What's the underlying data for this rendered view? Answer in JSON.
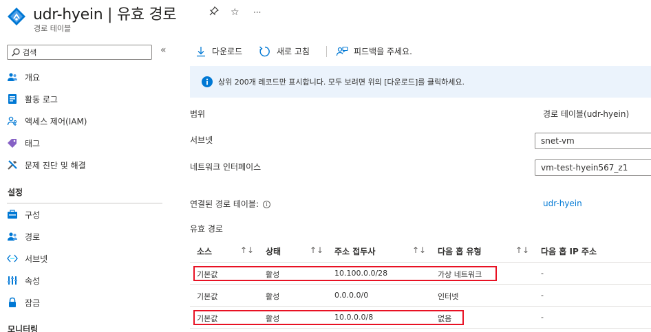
{
  "header": {
    "title": "udr-hyein | 유효 경로",
    "subtitle": "경로 테이블",
    "pin_glyph": "☆",
    "star_glyph": "☆",
    "more_glyph": "···"
  },
  "sidebar": {
    "search_placeholder": "검색",
    "collapse_glyph": "«",
    "items": [
      {
        "label": "개요",
        "icon": "overview-icon"
      },
      {
        "label": "활동 로그",
        "icon": "activity-log-icon"
      },
      {
        "label": "액세스 제어(IAM)",
        "icon": "iam-icon"
      },
      {
        "label": "태그",
        "icon": "tag-icon"
      },
      {
        "label": "문제 진단 및 해결",
        "icon": "wrench-icon"
      }
    ],
    "settings_header": "설정",
    "settings_items": [
      {
        "label": "구성",
        "icon": "configuration-icon"
      },
      {
        "label": "경로",
        "icon": "routes-icon"
      },
      {
        "label": "서브넷",
        "icon": "subnet-icon"
      },
      {
        "label": "속성",
        "icon": "properties-icon"
      },
      {
        "label": "잠금",
        "icon": "lock-icon"
      }
    ],
    "monitoring_header": "모니터링"
  },
  "toolbar": {
    "download": "다운로드",
    "refresh": "새로 고침",
    "feedback": "피드백을 주세요."
  },
  "info_bar": {
    "text": "상위 200개 레코드만 표시합니다. 모두 보려면 위의 [다운로드]를 클릭하세요."
  },
  "form": {
    "scope_label": "범위",
    "scope_value": "경로 테이블(udr-hyein)",
    "subnet_label": "서브넷",
    "subnet_value": "snet-vm",
    "nic_label": "네트워크 인터페이스",
    "nic_value": "vm-test-hyein567_z1",
    "associated_label": "연결된 경로 테이블:",
    "associated_value": "udr-hyein"
  },
  "routes": {
    "title": "유효 경로",
    "columns": [
      "소스",
      "상태",
      "주소 접두사",
      "다음 홉 유형",
      "다음 홉 IP 주소"
    ],
    "sort_glyph": "↑↓",
    "rows": [
      {
        "source": "기본값",
        "state": "활성",
        "prefix": "10.100.0.0/28",
        "next_hop_type": "가상 네트워크",
        "next_hop_ip": "-"
      },
      {
        "source": "기본값",
        "state": "활성",
        "prefix": "0.0.0.0/0",
        "next_hop_type": "인터넷",
        "next_hop_ip": "-"
      },
      {
        "source": "기본값",
        "state": "활성",
        "prefix": "10.0.0.0/8",
        "next_hop_type": "없음",
        "next_hop_ip": "-"
      }
    ]
  },
  "colors": {
    "accent": "#0078d4",
    "highlight": "#e81123",
    "info_bg": "#ebf3fc"
  }
}
